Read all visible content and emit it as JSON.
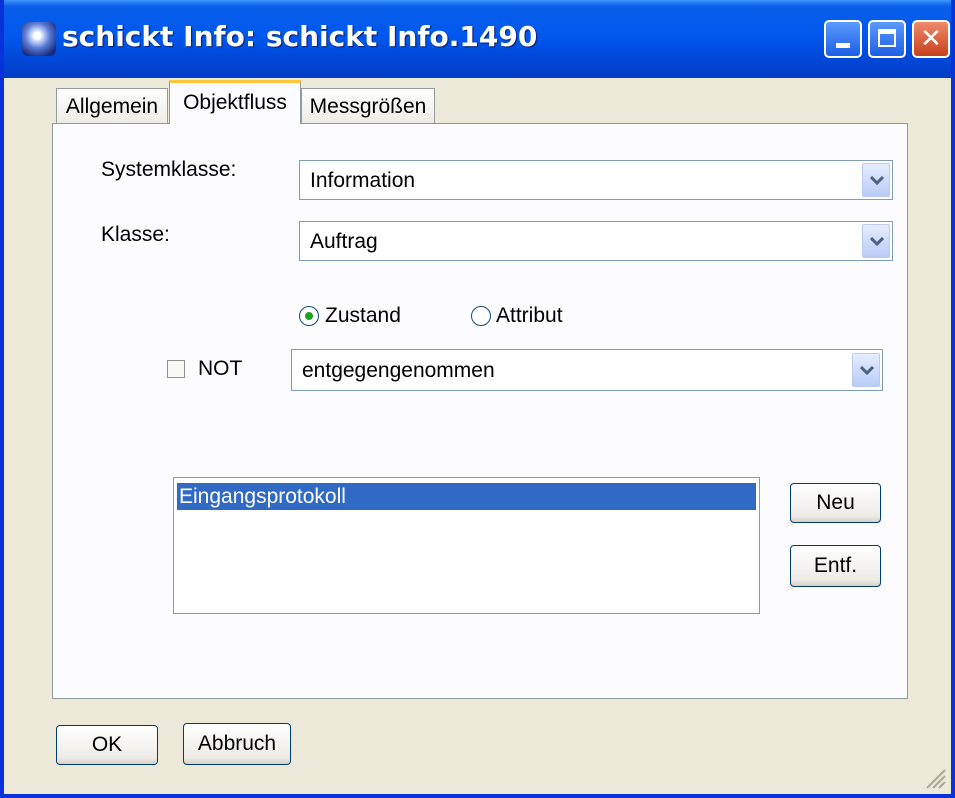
{
  "window": {
    "title": "schickt Info: schickt Info.1490",
    "icon": "app-globe-icon",
    "controls": [
      "minimize-icon",
      "maximize-icon",
      "close-icon"
    ]
  },
  "tabs": [
    {
      "label": "Allgemein",
      "selected": false
    },
    {
      "label": "Objektfluss",
      "selected": true
    },
    {
      "label": "Messgrößen",
      "selected": false
    }
  ],
  "form": {
    "systemklasse_label": "Systemklasse:",
    "systemklasse_value": "Information",
    "klasse_label": "Klasse:",
    "klasse_value": "Auftrag",
    "radio_zustand_label": "Zustand",
    "radio_zustand_selected": true,
    "radio_attribut_label": "Attribut",
    "radio_attribut_selected": false,
    "not_label": "NOT",
    "not_checked": false,
    "state_value": "entgegengenommen"
  },
  "list": {
    "items": [
      {
        "label": "Eingangsprotokoll",
        "selected": true
      }
    ]
  },
  "buttons": {
    "neu": "Neu",
    "entf": "Entf.",
    "ok": "OK",
    "abbruch": "Abbruch"
  },
  "colors": {
    "titlebar": "#0058ee",
    "selection": "#316ac5",
    "active_tab_accent": "#ffc83c",
    "radio_dot": "#21a121"
  }
}
